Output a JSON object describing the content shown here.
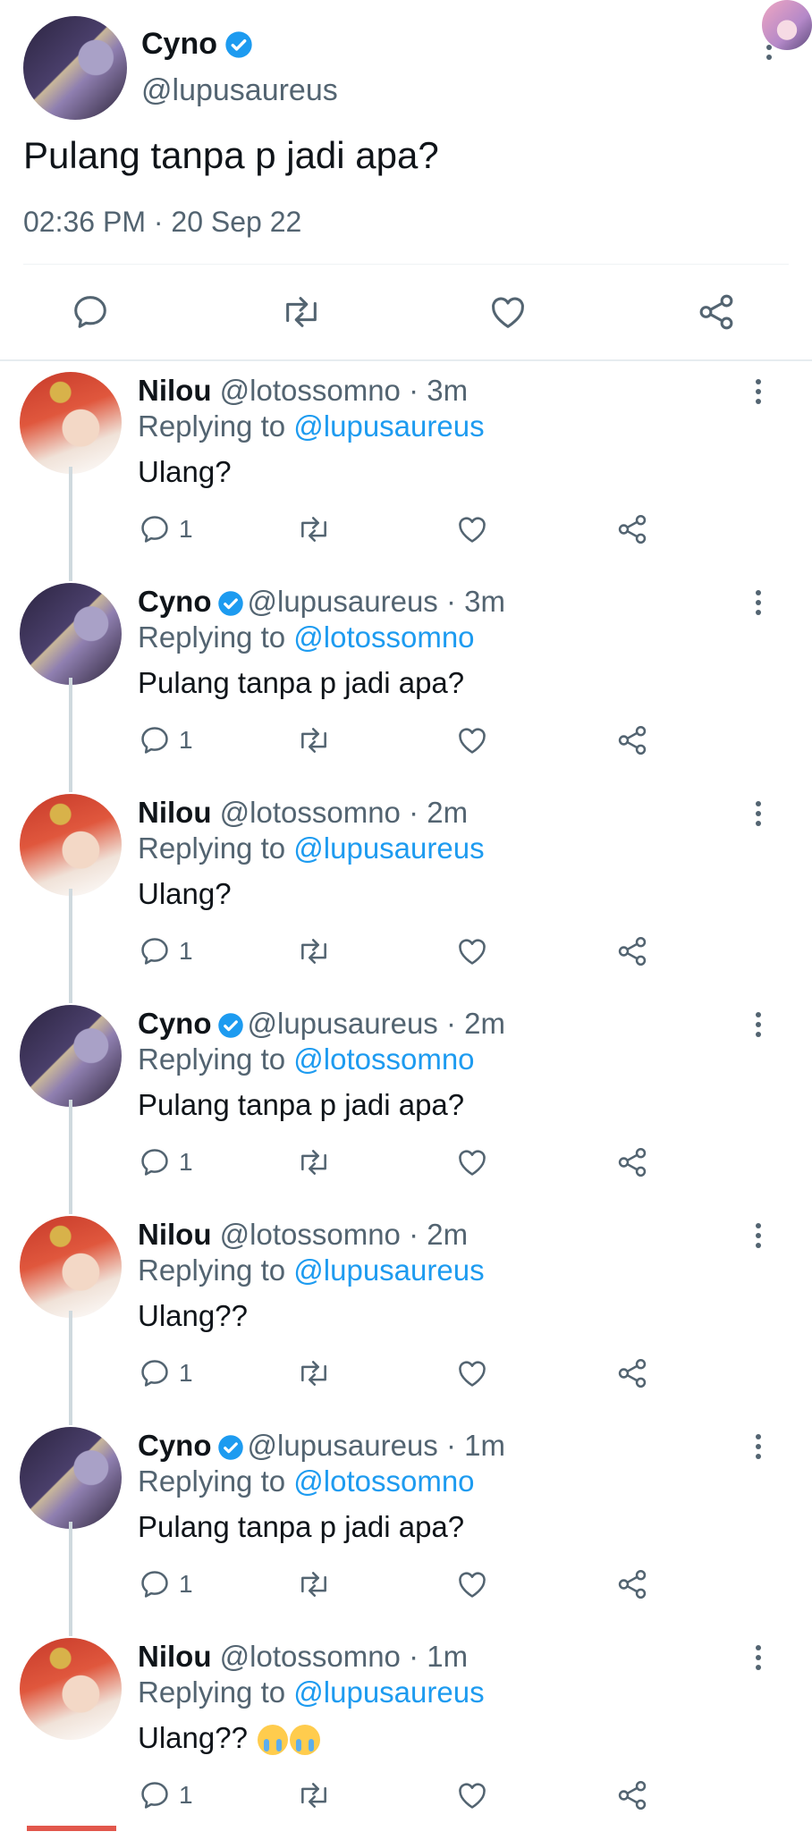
{
  "main_tweet": {
    "name": "Cyno",
    "handle": "@lupusaureus",
    "text": "Pulang tanpa p jadi apa?",
    "timestamp": "02:36 PM · 20 Sep 22"
  },
  "colors": {
    "accent": "#1d9bf0",
    "secondary_text": "#536471",
    "primary_text": "#0f1419"
  },
  "replies": [
    {
      "name": "Nilou",
      "meta": "@lotossomno · 3m",
      "replying_prefix": "Replying to",
      "replying_to": "@lupusaureus",
      "text": "Ulang?",
      "reply_count": "1"
    },
    {
      "name": "Cyno",
      "meta": "@lupusaureus · 3m",
      "replying_prefix": "Replying to",
      "replying_to": "@lotossomno",
      "text": "Pulang tanpa p jadi apa?",
      "reply_count": "1"
    },
    {
      "name": "Nilou",
      "meta": "@lotossomno · 2m",
      "replying_prefix": "Replying to",
      "replying_to": "@lupusaureus",
      "text": "Ulang?",
      "reply_count": "1"
    },
    {
      "name": "Cyno",
      "meta": "@lupusaureus · 2m",
      "replying_prefix": "Replying to",
      "replying_to": "@lotossomno",
      "text": "Pulang tanpa p jadi apa?",
      "reply_count": "1"
    },
    {
      "name": "Nilou",
      "meta": "@lotossomno · 2m",
      "replying_prefix": "Replying to",
      "replying_to": "@lupusaureus",
      "text": "Ulang??",
      "reply_count": "1"
    },
    {
      "name": "Cyno",
      "meta": "@lupusaureus · 1m",
      "replying_prefix": "Replying to",
      "replying_to": "@lotossomno",
      "text": "Pulang tanpa p jadi apa?",
      "reply_count": "1"
    },
    {
      "name": "Nilou",
      "meta": "@lotossomno · 1m",
      "replying_prefix": "Replying to",
      "replying_to": "@lupusaureus",
      "text": "Ulang??",
      "reply_count": "1"
    }
  ],
  "icons": [
    "reply-icon",
    "retweet-icon",
    "like-icon",
    "share-icon",
    "more-icon",
    "verified-icon",
    "crying-emoji-icon"
  ]
}
